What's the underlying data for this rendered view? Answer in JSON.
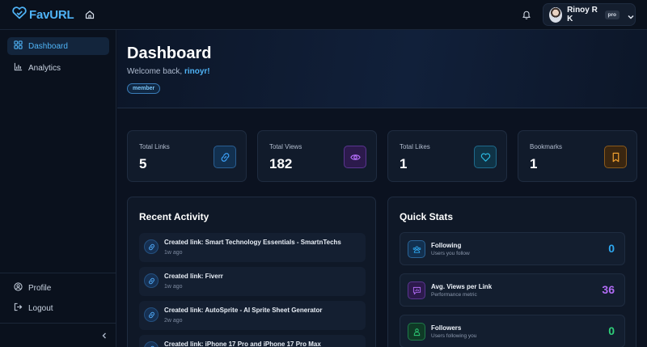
{
  "app": {
    "name": "FavURL"
  },
  "user": {
    "name": "Rinoy R K",
    "plan_badge": "pro"
  },
  "sidebar": {
    "items": [
      {
        "label": "Dashboard",
        "icon": "grid-icon",
        "active": true
      },
      {
        "label": "Analytics",
        "icon": "bar-chart-icon",
        "active": false
      }
    ],
    "bottom_items": [
      {
        "label": "Profile",
        "icon": "user-circle-icon"
      },
      {
        "label": "Logout",
        "icon": "logout-icon"
      }
    ]
  },
  "header": {
    "title": "Dashboard",
    "welcome_prefix": "Welcome back, ",
    "username": "rinoyr!",
    "role_badge": "member"
  },
  "stats": [
    {
      "label": "Total Links",
      "value": "5",
      "icon": "link-icon",
      "color": "#3b9ef5"
    },
    {
      "label": "Total Views",
      "value": "182",
      "icon": "eye-icon",
      "color": "#b16cf5"
    },
    {
      "label": "Total Likes",
      "value": "1",
      "icon": "heart-icon",
      "color": "#2ab8e0"
    },
    {
      "label": "Bookmarks",
      "value": "1",
      "icon": "bookmark-icon",
      "color": "#f0a030"
    }
  ],
  "recent_activity": {
    "title": "Recent Activity",
    "items": [
      {
        "title": "Created link: Smart Technology Essentials - SmartnTechs",
        "time": "1w ago"
      },
      {
        "title": "Created link: Fiverr",
        "time": "1w ago"
      },
      {
        "title": "Created link: AutoSprite - AI Sprite Sheet Generator",
        "time": "2w ago"
      },
      {
        "title": "Created link: iPhone 17 Pro and iPhone 17 Pro Max",
        "time": ""
      }
    ]
  },
  "quick_stats": {
    "title": "Quick Stats",
    "items": [
      {
        "title": "Following",
        "subtitle": "Users you follow",
        "value": "0",
        "icon": "users-icon",
        "color": "#2ea8f0"
      },
      {
        "title": "Avg. Views per Link",
        "subtitle": "Performance metric",
        "value": "36",
        "icon": "chart-message-icon",
        "color": "#b16cf5"
      },
      {
        "title": "Followers",
        "subtitle": "Users following you",
        "value": "0",
        "icon": "user-group-icon",
        "color": "#2fd17a"
      }
    ]
  }
}
